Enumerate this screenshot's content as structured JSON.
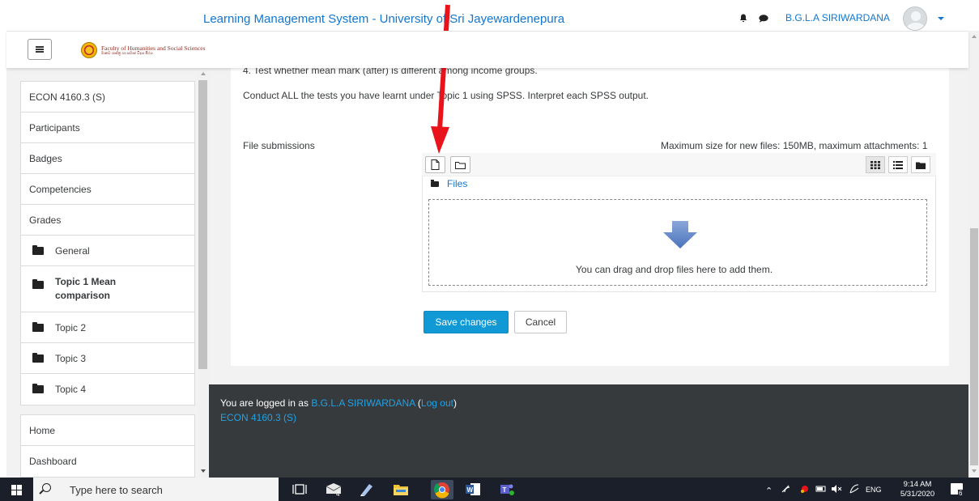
{
  "header": {
    "logo_line1": "Faculty of Humanities and Social Sciences",
    "logo_line2": "මානව ශාස්ත්‍ර හා සමාජ විද්‍යා පීඨය",
    "site_title": "Learning Management System - University of Sri Jayewardenepura",
    "user_name": "B.G.L.A SIRIWARDANA"
  },
  "sidebar": {
    "course_items": [
      {
        "label": "ECON 4160.3 (S)"
      },
      {
        "label": "Participants"
      },
      {
        "label": "Badges"
      },
      {
        "label": "Competencies"
      },
      {
        "label": "Grades"
      },
      {
        "label": "General"
      },
      {
        "label": "Topic 1 Mean comparison"
      },
      {
        "label": "Topic 2"
      },
      {
        "label": "Topic 3"
      },
      {
        "label": "Topic 4"
      }
    ],
    "site_items": [
      {
        "label": "Home"
      },
      {
        "label": "Dashboard"
      }
    ]
  },
  "main": {
    "question_4": "4. Test whether mean mark (after) is different among income groups.",
    "instruction": "Conduct ALL the tests you have learnt under Topic 1 using SPSS.  Interpret each SPSS output.",
    "file_submissions_label": "File submissions",
    "max_size_text": "Maximum size for new files: 150MB, maximum attachments: 1",
    "path_label": "Files",
    "drop_text": "You can drag and drop files here to add them.",
    "save_label": "Save changes",
    "cancel_label": "Cancel"
  },
  "footer": {
    "logged_in_prefix": "You are logged in as ",
    "user_link": "B.G.L.A SIRIWARDANA",
    "logout_open": " (",
    "logout_label": "Log out",
    "logout_close": ")",
    "course_link": "ECON 4160.3 (S)"
  },
  "taskbar": {
    "search_placeholder": "Type here to search",
    "mail_badge": "4",
    "language": "ENG",
    "time": "9:14 AM",
    "date": "5/31/2020",
    "notification_count": "6"
  },
  "colors": {
    "link_blue": "#1177d1",
    "primary_button": "#1199d6",
    "footer_bg": "#373a3c",
    "annotation_red": "#e8131b"
  }
}
